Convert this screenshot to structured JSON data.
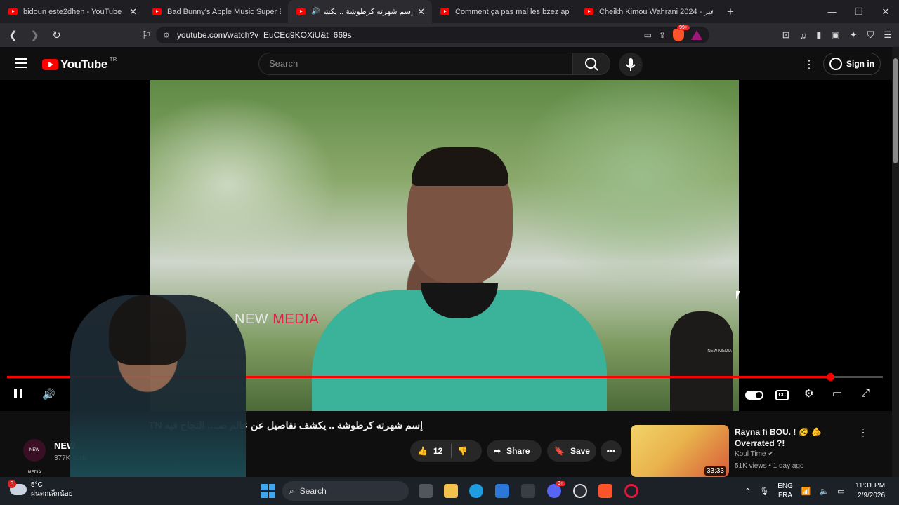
{
  "browser": {
    "tabs": [
      {
        "label": "bidoun este2dhen - YouTube",
        "active": false
      },
      {
        "label": "Bad Bunny's Apple Music Super Bowl",
        "active": false
      },
      {
        "label": "إسم شهرته كرطوشة .. يكشف تفا",
        "active": true
      },
      {
        "label": "Comment ça pas mal les bzez apex ?",
        "active": false
      },
      {
        "label": "Cheikh Kimou Wahrani 2024 - صغير",
        "active": false
      }
    ],
    "url": "youtube.com/watch?v=EuCEq9KOXiU&t=669s",
    "shield_badge": "99+"
  },
  "youtube": {
    "logo_text": "YouTube",
    "country_code": "TR",
    "search_placeholder": "Search",
    "signin_label": "Sign in"
  },
  "video": {
    "watermark_white": "NEW ",
    "watermark_red": "MEDIA",
    "watermark_corner": "NEW MEDIA",
    "progress": 0.94,
    "title": "إسم شهرته كرطوشة .. يكشف تفاصيل عن عالم صـ... التجاح فيه TN",
    "channel_avatar_text": "NEW MEDIA",
    "channel_name": "NEW",
    "subscribers": "377K subs",
    "likes": "12",
    "share_label": "Share",
    "save_label": "Save"
  },
  "recommendation": {
    "title": "Rayna fi BOU. ! 🫨 🫵 Overrated ?!",
    "channel": "Koul Time",
    "meta": "51K views • 1 day ago",
    "duration": "33:33"
  },
  "taskbar": {
    "weather_badge": "3",
    "temperature": "5°C",
    "weather_desc": "ฝนตกเล็กน้อย",
    "search_label": "Search",
    "lang_top": "ENG",
    "lang_bottom": "FRA",
    "time": "11:31 PM",
    "date": "2/9/2026",
    "discord_badge": "9+"
  }
}
